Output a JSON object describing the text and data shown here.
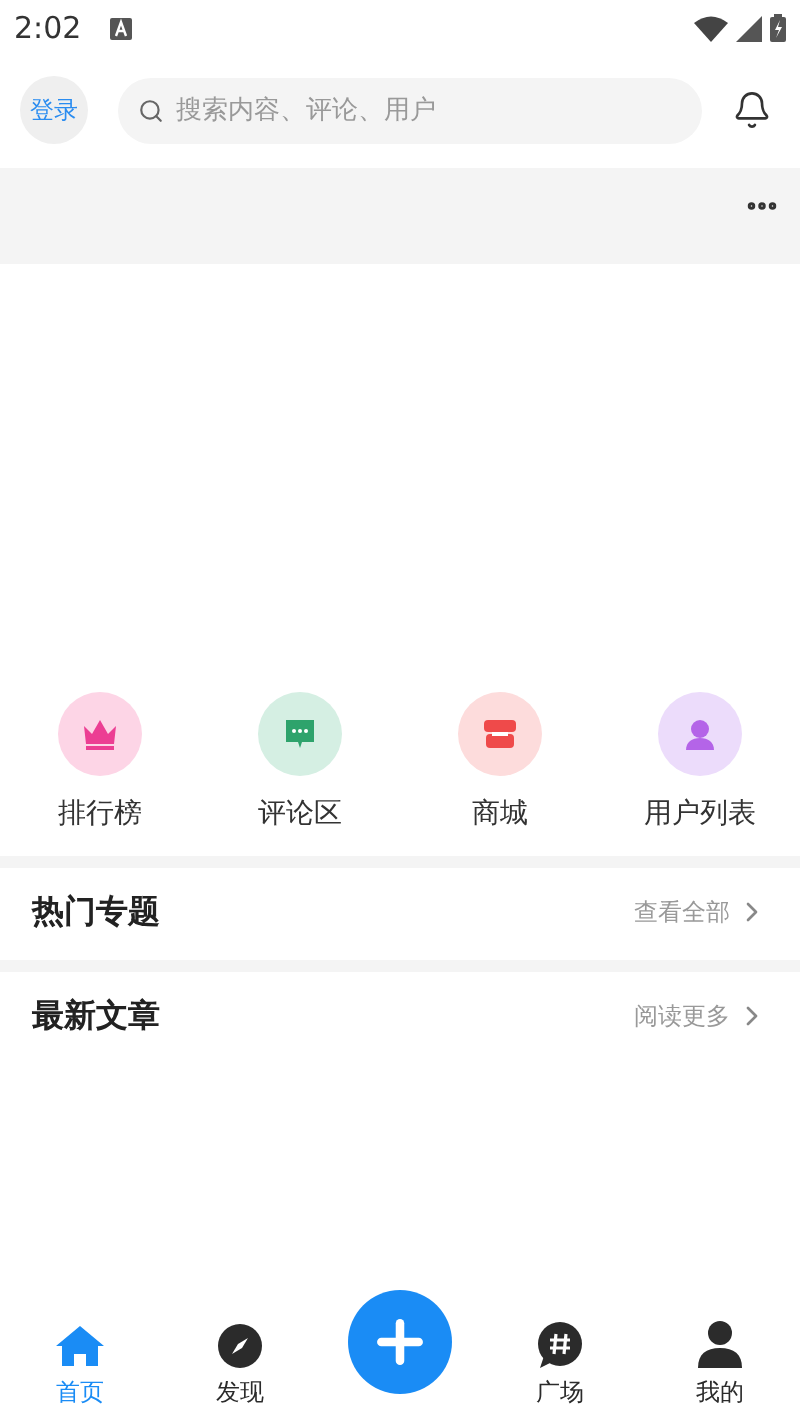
{
  "status_bar": {
    "time": "2:02"
  },
  "header": {
    "login": "登录",
    "search": {
      "placeholder": "搜索内容、评论、用户"
    }
  },
  "shortcuts": [
    {
      "label": "排行榜",
      "kind": "crown",
      "color": "#fdd5e6"
    },
    {
      "label": "评论区",
      "kind": "chat",
      "color": "#d5efe3"
    },
    {
      "label": "商城",
      "kind": "store",
      "color": "#fddcdc"
    },
    {
      "label": "用户列表",
      "kind": "user",
      "color": "#ecdcfb"
    }
  ],
  "sections": [
    {
      "title": "热门专题",
      "link": "查看全部"
    },
    {
      "title": "最新文章",
      "link": "阅读更多"
    }
  ],
  "bottom_nav": [
    {
      "kind": "home",
      "label": "首页",
      "selected": true
    },
    {
      "kind": "compass",
      "label": "发现",
      "selected": false
    },
    {
      "kind": "add"
    },
    {
      "kind": "hash",
      "label": "广场",
      "selected": false
    },
    {
      "kind": "person",
      "label": "我的",
      "selected": false
    }
  ]
}
